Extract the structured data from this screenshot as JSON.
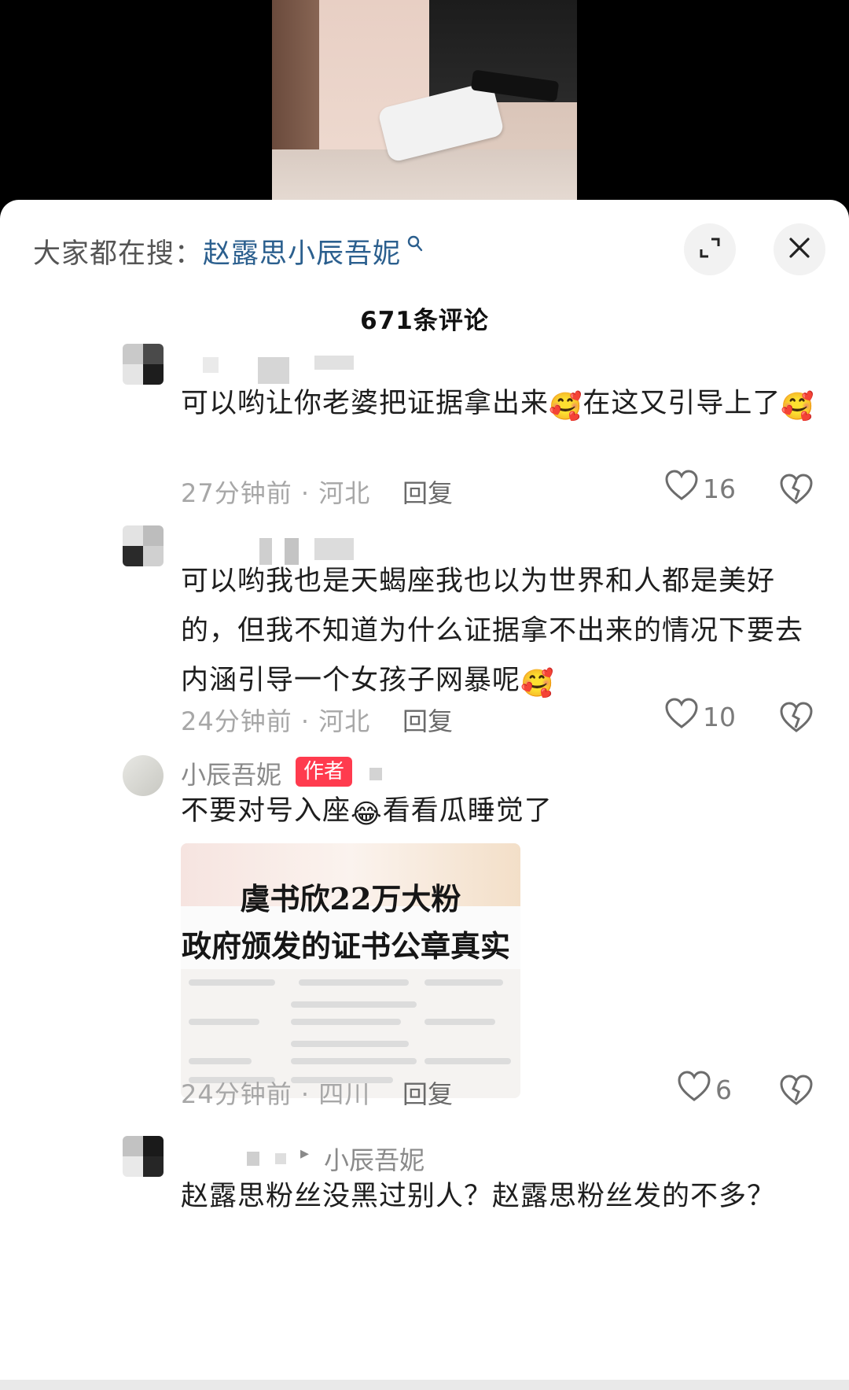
{
  "header": {
    "search_prefix": "大家都在搜：",
    "search_term": "赵露思小辰吾妮",
    "comment_count": "671条评论",
    "icons": [
      "search-icon",
      "expand-icon",
      "close-icon"
    ]
  },
  "comments": [
    {
      "text_parts": [
        "可以哟让你老婆把证据拿出来",
        "🥰",
        "在这又引导上了",
        "🥰"
      ],
      "time": "27分钟前 · 河北",
      "reply_label": "回复",
      "likes": "16"
    },
    {
      "text_parts": [
        "可以哟我也是天蝎座我也以为世界和人都是美好的，但我不知道为什么证据拿不出来的情况下要去内涵引导一个女孩子网暴呢",
        "🥰"
      ],
      "time": "24分钟前 · 河北",
      "reply_label": "回复",
      "likes": "10"
    },
    {
      "author": "小辰吾妮",
      "badge": "作者",
      "text_parts": [
        "不要对号入座",
        "😂",
        "看看瓜睡觉了"
      ],
      "image": {
        "headline_1": "虞书欣22万大粉",
        "headline_2": "政府颁发的证书公章真实"
      },
      "time": "24分钟前 · 四川",
      "reply_label": "回复",
      "likes": "6"
    },
    {
      "reply_to": "小辰吾妮",
      "text": "赵露思粉丝没黑过别人？赵露思粉丝发的不多？"
    }
  ],
  "colors": {
    "search_term": "#2b5f8e",
    "author_badge": "#ff3b4e"
  }
}
